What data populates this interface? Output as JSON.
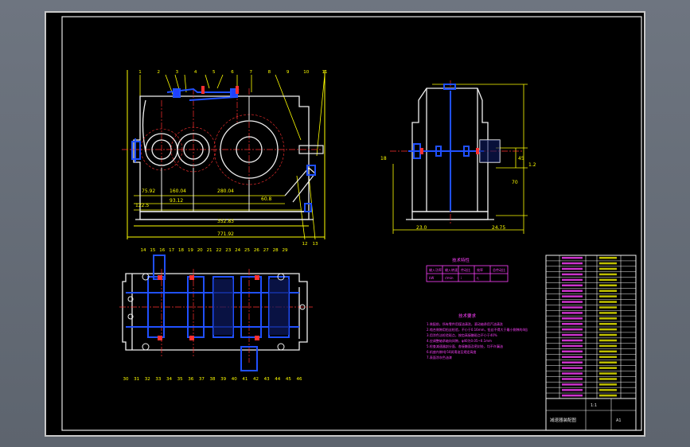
{
  "drawing": {
    "front_view": {
      "dims": {
        "d1": "75.92",
        "d2": "160.04",
        "d3": "280.04",
        "d4": "60.8",
        "d5": "93.12",
        "d6": "122.5",
        "overall": "352.83",
        "bottom": "771.92"
      },
      "balloon_labels_top": [
        "1",
        "2",
        "3",
        "4",
        "5",
        "6",
        "7",
        "8",
        "9",
        "10",
        "11"
      ],
      "balloon_labels_right": [
        "12",
        "13"
      ]
    },
    "side_view": {
      "dims": {
        "left_base": "23.0",
        "right_base": "24.75",
        "height": "70",
        "h2": "45",
        "h3": "1.2",
        "shaft": "18"
      }
    },
    "plan_view": {
      "balloon_labels_top": [
        "14",
        "15",
        "16",
        "17",
        "18",
        "19",
        "20",
        "21",
        "22",
        "23",
        "24",
        "25",
        "26",
        "27",
        "28",
        "29"
      ],
      "balloon_labels_bottom": [
        "30",
        "31",
        "32",
        "33",
        "34",
        "35",
        "36",
        "37",
        "38",
        "39",
        "40",
        "41",
        "42",
        "43",
        "44",
        "45",
        "46"
      ]
    },
    "spec_table": {
      "title": "技术特性",
      "rows": [
        [
          "输入功率",
          "输入转速",
          "传动比",
          "效率",
          "总传动比"
        ],
        [
          "kW",
          "r/min",
          "i",
          "η",
          ""
        ]
      ]
    },
    "tech_notes": {
      "title": "技术要求",
      "lines": [
        "1.装配前，所有零件用煤油清洗，滚动轴承用汽油清洗",
        "2.啮合侧隙用铅丝检验，不小于0.16mm，铅丝不得大于最小侧隙的4倍",
        "3.用涂色法检验斑点，按齿高接触斑点不小于40%",
        "4.应调整轴承轴向间隙，φ40为0.05~0.1mm",
        "5.检查减速器剖分面、各接触面及密封处，均不许漏油",
        "6.机座内装HJ-50润滑油至规定高度",
        "7.表面涂灰色油漆"
      ]
    },
    "parts_list": {
      "rows": 26,
      "title_block": {
        "drawing_title": "减速器装配图",
        "scale": "1:1",
        "sheet": "A1"
      }
    }
  }
}
